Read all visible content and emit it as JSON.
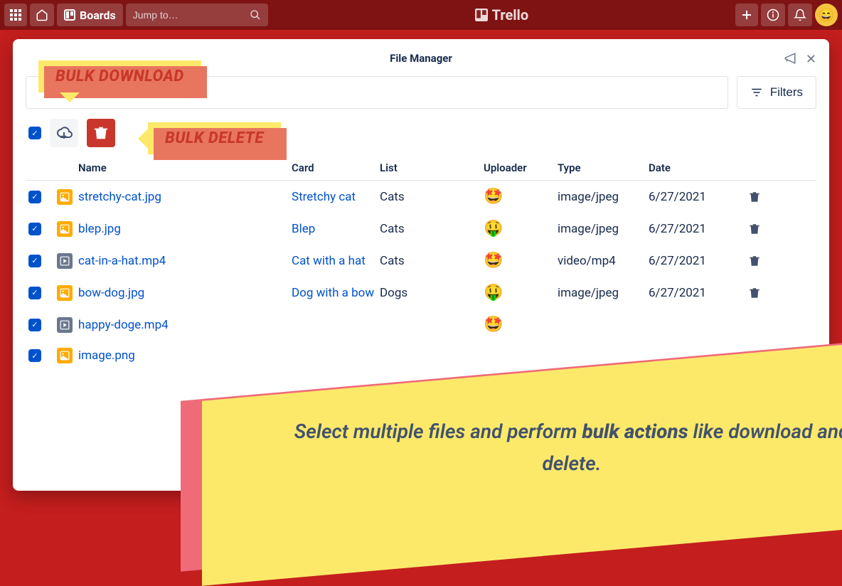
{
  "trello_bar": {
    "boards_label": "Boards",
    "search_placeholder": "Jump to…",
    "brand": "Trello"
  },
  "modal": {
    "title": "File Manager",
    "filters_label": "Filters"
  },
  "callouts": {
    "download": "BULK DOWNLOAD",
    "delete": "BULK DELETE"
  },
  "columns": {
    "name": "Name",
    "card": "Card",
    "list": "List",
    "uploader": "Uploader",
    "type": "Type",
    "date": "Date"
  },
  "files": [
    {
      "name": "stretchy-cat.jpg",
      "icon": "img",
      "card": "Stretchy cat",
      "list": "Cats",
      "uploader": "🤩",
      "type": "image/jpeg",
      "date": "6/27/2021"
    },
    {
      "name": "blep.jpg",
      "icon": "img",
      "card": "Blep",
      "list": "Cats",
      "uploader": "🤑",
      "type": "image/jpeg",
      "date": "6/27/2021"
    },
    {
      "name": "cat-in-a-hat.mp4",
      "icon": "vid",
      "card": "Cat with a hat",
      "list": "Cats",
      "uploader": "🤩",
      "type": "video/mp4",
      "date": "6/27/2021"
    },
    {
      "name": "bow-dog.jpg",
      "icon": "img",
      "card": "Dog with a bow",
      "list": "Dogs",
      "uploader": "🤑",
      "type": "image/jpeg",
      "date": "6/27/2021"
    },
    {
      "name": "happy-doge.mp4",
      "icon": "vid",
      "card": "",
      "list": "",
      "uploader": "🤩",
      "type": "",
      "date": ""
    },
    {
      "name": "image.png",
      "icon": "img",
      "card": "",
      "list": "",
      "uploader": "",
      "type": "",
      "date": ""
    }
  ],
  "banner": {
    "text_pre": "Select multiple files and perform ",
    "text_bold": "bulk actions",
    "text_post": " like download and delete."
  }
}
